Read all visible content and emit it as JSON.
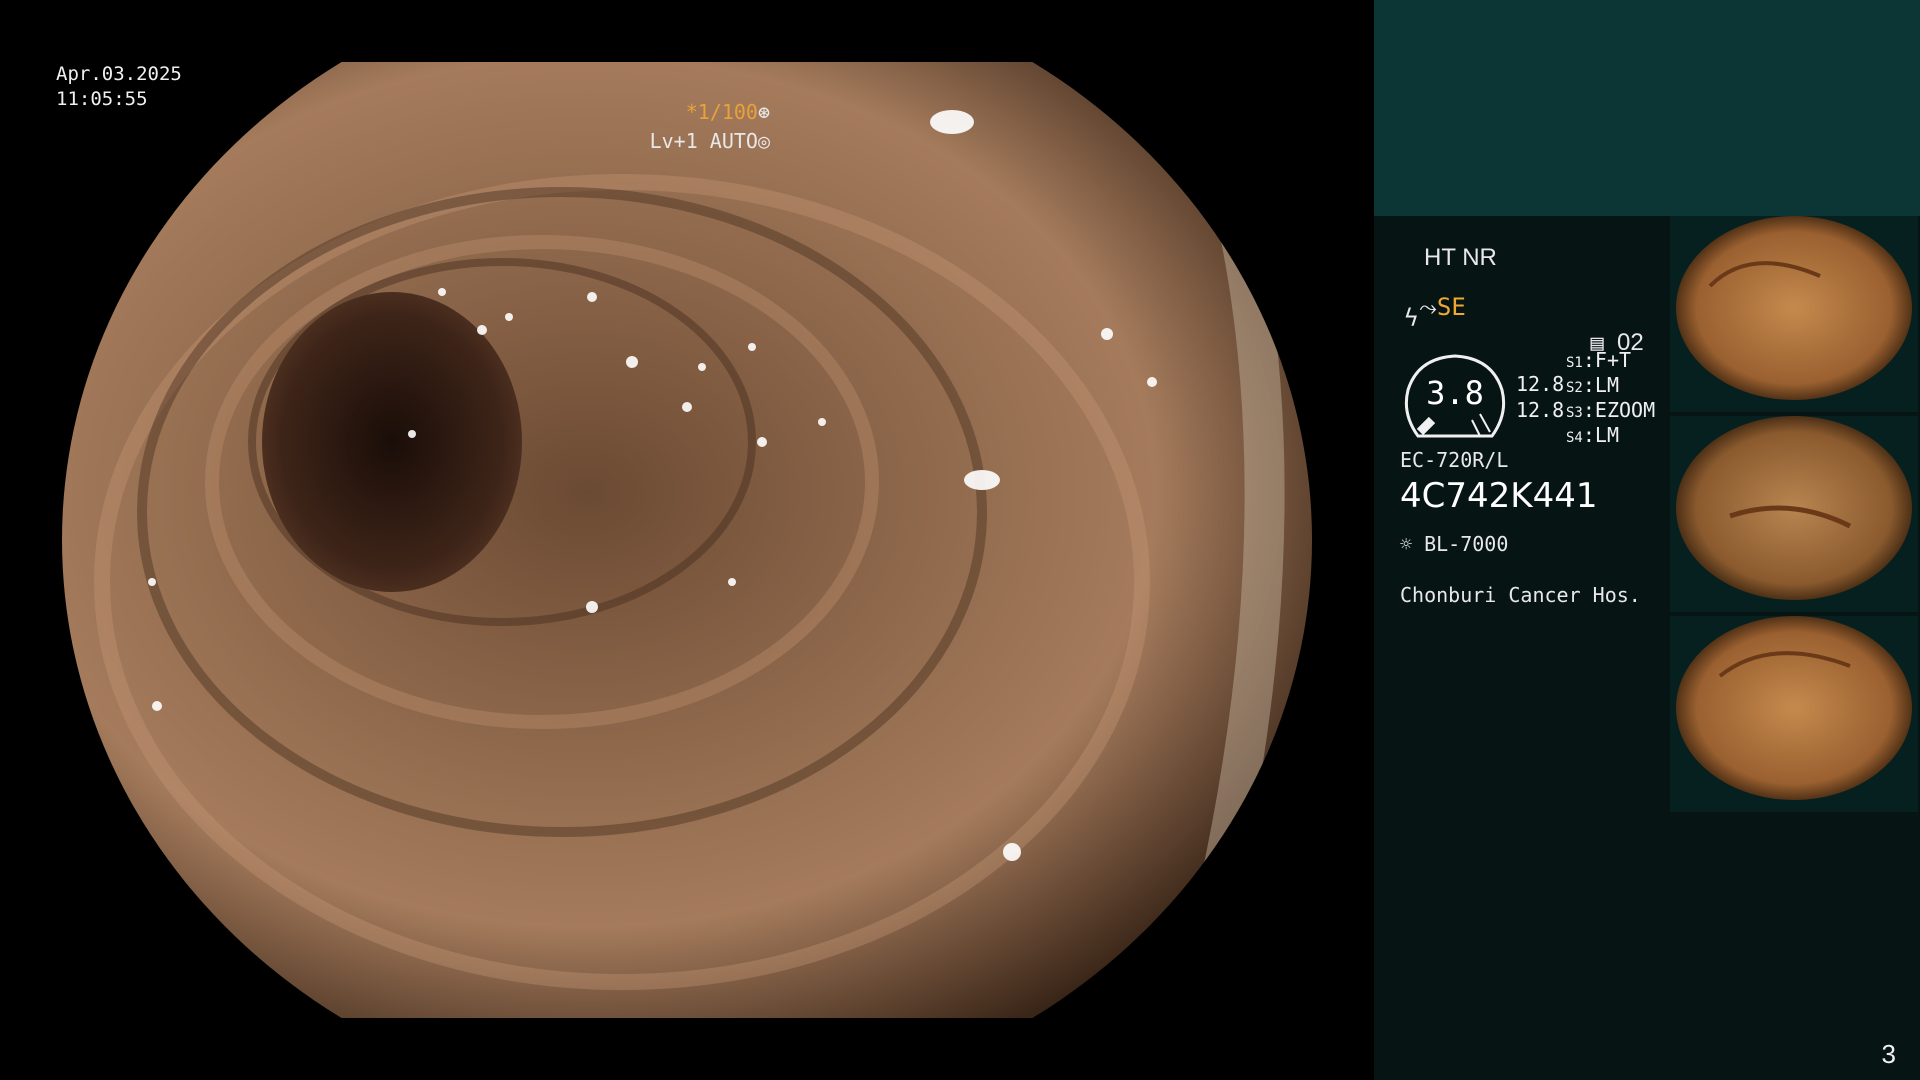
{
  "overlay": {
    "date": "Apr.03.2025",
    "time": "11:05:55",
    "shutter": "*1/100",
    "level": "Lv+1 AUTO"
  },
  "panel": {
    "ht_nr": "HT NR",
    "se": "SE",
    "memo_num": "02",
    "gauge_value": "3.8",
    "left_values": [
      "12.8",
      "12.8"
    ],
    "switches": [
      {
        "key": "S1",
        "val": "F+T"
      },
      {
        "key": "S2",
        "val": "LM"
      },
      {
        "key": "S3",
        "val": "EZOOM"
      },
      {
        "key": "S4",
        "val": "LM"
      }
    ],
    "scope_model": "EC-720R/L",
    "serial": "4C742K441",
    "light_source": "BL-7000",
    "hospital": "Chonburi Cancer Hos."
  },
  "thumbnails_count": 3,
  "page_number": "3",
  "colors": {
    "panel_top": "#0c3535",
    "panel": "#071414",
    "accent": "#f0a830"
  }
}
